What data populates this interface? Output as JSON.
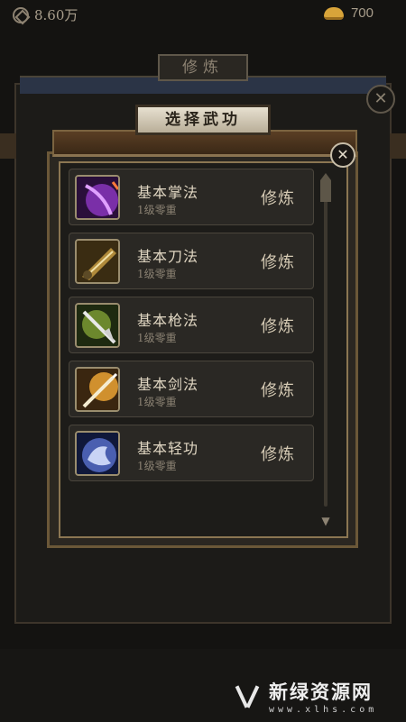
{
  "status": {
    "coin_value": "8.60万",
    "gold_value": "700"
  },
  "background_panel": {
    "title": "修炼"
  },
  "popup": {
    "title": "选择武功",
    "close_symbol": "✕"
  },
  "skills": [
    {
      "name": "基本掌法",
      "level": "1级零重",
      "action": "修炼",
      "icon": "palm-skill-icon",
      "color": "#7a2fa8"
    },
    {
      "name": "基本刀法",
      "level": "1级零重",
      "action": "修炼",
      "icon": "blade-skill-icon",
      "color": "#b08a3a"
    },
    {
      "name": "基本枪法",
      "level": "1级零重",
      "action": "修炼",
      "icon": "spear-skill-icon",
      "color": "#8db03a"
    },
    {
      "name": "基本剑法",
      "level": "1级零重",
      "action": "修炼",
      "icon": "sword-skill-icon",
      "color": "#d0902e"
    },
    {
      "name": "基本轻功",
      "level": "1级零重",
      "action": "修炼",
      "icon": "lightness-skill-icon",
      "color": "#4a5fb0"
    }
  ],
  "watermark": {
    "main": "新绿资源网",
    "sub": "www.xlhs.com"
  }
}
